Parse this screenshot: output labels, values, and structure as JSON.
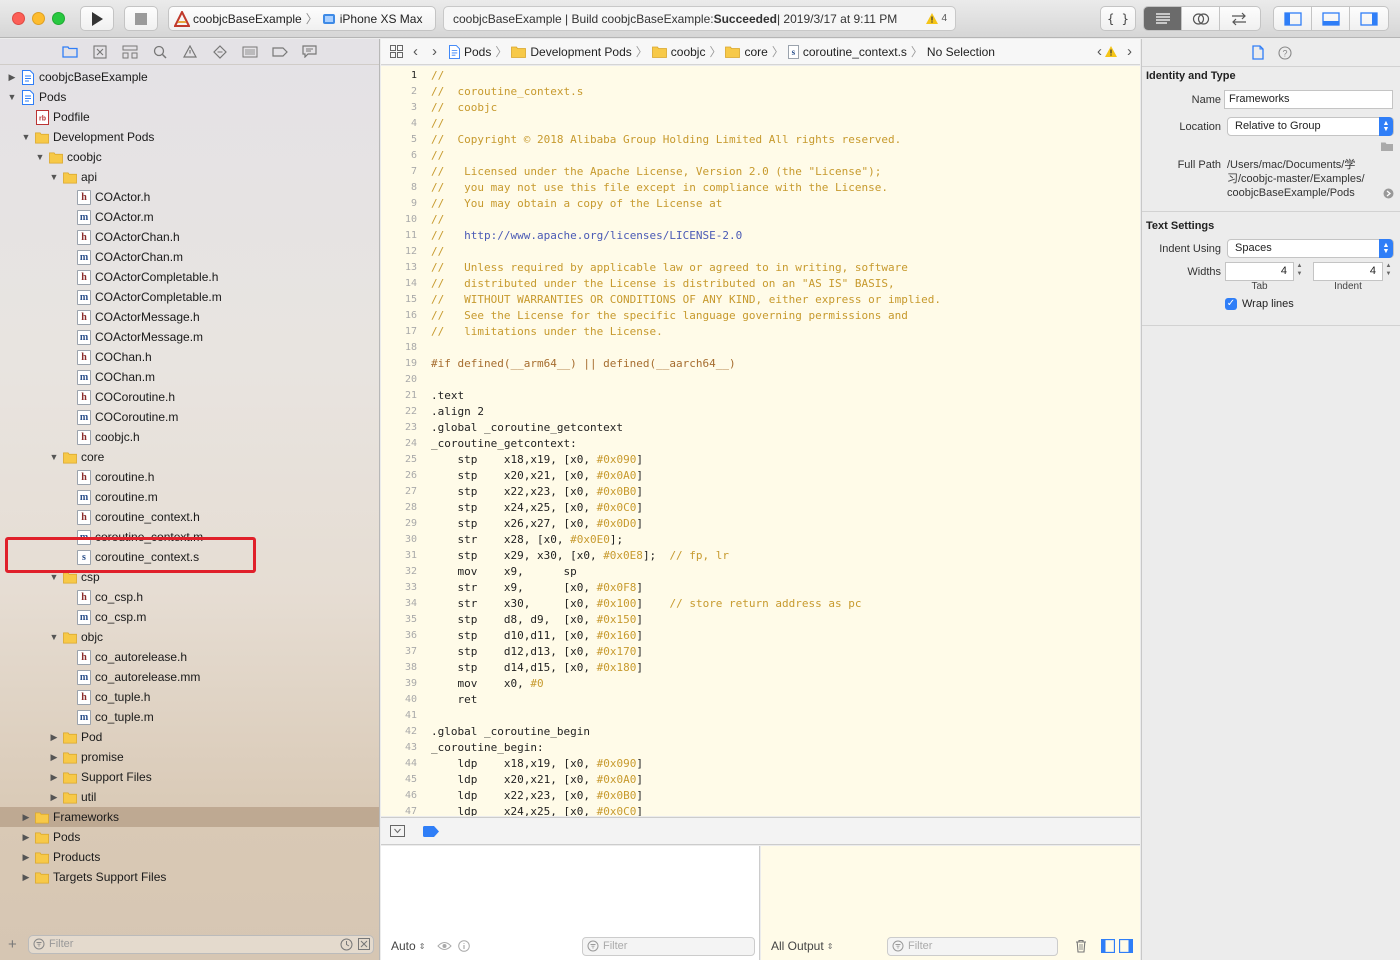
{
  "toolbar": {
    "scheme_name": "coobjcBaseExample",
    "device_name": "iPhone XS Max",
    "activity_prefix": "coobjcBaseExample | Build coobjcBaseExample: ",
    "activity_status": "Succeeded",
    "activity_time": " | 2019/3/17 at 9:11 PM",
    "warning_count": "4",
    "colors": {
      "close": "#fc5f57",
      "minimize": "#fdbc2e",
      "zoom": "#28c840",
      "accent": "#2f7ef7"
    }
  },
  "navigator": {
    "tabs": [
      "folder-icon",
      "source-control-icon",
      "symbol-icon",
      "search-icon",
      "issue-icon",
      "test-icon",
      "debug-icon",
      "breakpoint-icon",
      "report-icon"
    ],
    "items": [
      {
        "label": "coobjcBaseExample",
        "kind": "project",
        "disclosure": "closed",
        "indent": 0
      },
      {
        "label": "Pods",
        "kind": "project",
        "disclosure": "open",
        "indent": 0
      },
      {
        "label": "Podfile",
        "kind": "rb",
        "disclosure": "",
        "indent": 1
      },
      {
        "label": "Development Pods",
        "kind": "folder",
        "disclosure": "open",
        "indent": 1
      },
      {
        "label": "coobjc",
        "kind": "folder",
        "disclosure": "open",
        "indent": 2
      },
      {
        "label": "api",
        "kind": "folder",
        "disclosure": "open",
        "indent": 3
      },
      {
        "label": "COActor.h",
        "kind": "h",
        "disclosure": "",
        "indent": 4
      },
      {
        "label": "COActor.m",
        "kind": "m",
        "disclosure": "",
        "indent": 4
      },
      {
        "label": "COActorChan.h",
        "kind": "h",
        "disclosure": "",
        "indent": 4
      },
      {
        "label": "COActorChan.m",
        "kind": "m",
        "disclosure": "",
        "indent": 4
      },
      {
        "label": "COActorCompletable.h",
        "kind": "h",
        "disclosure": "",
        "indent": 4
      },
      {
        "label": "COActorCompletable.m",
        "kind": "m",
        "disclosure": "",
        "indent": 4
      },
      {
        "label": "COActorMessage.h",
        "kind": "h",
        "disclosure": "",
        "indent": 4
      },
      {
        "label": "COActorMessage.m",
        "kind": "m",
        "disclosure": "",
        "indent": 4
      },
      {
        "label": "COChan.h",
        "kind": "h",
        "disclosure": "",
        "indent": 4
      },
      {
        "label": "COChan.m",
        "kind": "m",
        "disclosure": "",
        "indent": 4
      },
      {
        "label": "COCoroutine.h",
        "kind": "h",
        "disclosure": "",
        "indent": 4
      },
      {
        "label": "COCoroutine.m",
        "kind": "m",
        "disclosure": "",
        "indent": 4
      },
      {
        "label": "coobjc.h",
        "kind": "h",
        "disclosure": "",
        "indent": 4
      },
      {
        "label": "core",
        "kind": "folder",
        "disclosure": "open",
        "indent": 3
      },
      {
        "label": "coroutine.h",
        "kind": "h",
        "disclosure": "",
        "indent": 4
      },
      {
        "label": "coroutine.m",
        "kind": "m",
        "disclosure": "",
        "indent": 4
      },
      {
        "label": "coroutine_context.h",
        "kind": "h",
        "disclosure": "",
        "indent": 4
      },
      {
        "label": "coroutine_context.m",
        "kind": "m",
        "disclosure": "",
        "indent": 4
      },
      {
        "label": "coroutine_context.s",
        "kind": "s",
        "disclosure": "",
        "indent": 4
      },
      {
        "label": "csp",
        "kind": "folder",
        "disclosure": "open",
        "indent": 3
      },
      {
        "label": "co_csp.h",
        "kind": "h",
        "disclosure": "",
        "indent": 4
      },
      {
        "label": "co_csp.m",
        "kind": "m",
        "disclosure": "",
        "indent": 4
      },
      {
        "label": "objc",
        "kind": "folder",
        "disclosure": "open",
        "indent": 3
      },
      {
        "label": "co_autorelease.h",
        "kind": "h",
        "disclosure": "",
        "indent": 4
      },
      {
        "label": "co_autorelease.mm",
        "kind": "m",
        "disclosure": "",
        "indent": 4
      },
      {
        "label": "co_tuple.h",
        "kind": "h",
        "disclosure": "",
        "indent": 4
      },
      {
        "label": "co_tuple.m",
        "kind": "m",
        "disclosure": "",
        "indent": 4
      },
      {
        "label": "Pod",
        "kind": "folder",
        "disclosure": "closed",
        "indent": 3
      },
      {
        "label": "promise",
        "kind": "folder",
        "disclosure": "closed",
        "indent": 3
      },
      {
        "label": "Support Files",
        "kind": "folder",
        "disclosure": "closed",
        "indent": 3
      },
      {
        "label": "util",
        "kind": "folder",
        "disclosure": "closed",
        "indent": 3
      },
      {
        "label": "Frameworks",
        "kind": "folder",
        "disclosure": "closed",
        "indent": 1,
        "selected": true
      },
      {
        "label": "Pods",
        "kind": "folder",
        "disclosure": "closed",
        "indent": 1
      },
      {
        "label": "Products",
        "kind": "folder",
        "disclosure": "closed",
        "indent": 1
      },
      {
        "label": "Targets Support Files",
        "kind": "folder",
        "disclosure": "closed",
        "indent": 1
      }
    ],
    "filter_placeholder": "Filter"
  },
  "jumpbar": {
    "crumbs": [
      "Pods",
      "Development Pods",
      "coobjc",
      "core",
      "coroutine_context.s",
      "No Selection"
    ]
  },
  "editor": {
    "current_line": 1,
    "lines": [
      {
        "n": "1",
        "t": "//",
        "k": "cmt"
      },
      {
        "n": "2",
        "t": "//  coroutine_context.s",
        "k": "cmt"
      },
      {
        "n": "3",
        "t": "//  coobjc",
        "k": "cmt"
      },
      {
        "n": "4",
        "t": "//",
        "k": "cmt"
      },
      {
        "n": "5",
        "t": "//  Copyright © 2018 Alibaba Group Holding Limited All rights reserved.",
        "k": "cmt"
      },
      {
        "n": "6",
        "t": "//",
        "k": "cmt"
      },
      {
        "n": "7",
        "t": "//   Licensed under the Apache License, Version 2.0 (the \"License\");",
        "k": "cmt"
      },
      {
        "n": "8",
        "t": "//   you may not use this file except in compliance with the License.",
        "k": "cmt"
      },
      {
        "n": "9",
        "t": "//   You may obtain a copy of the License at",
        "k": "cmt"
      },
      {
        "n": "10",
        "t": "//",
        "k": "cmt"
      },
      {
        "n": "11",
        "t": "//   http://www.apache.org/licenses/LICENSE-2.0",
        "k": "url"
      },
      {
        "n": "12",
        "t": "//",
        "k": "cmt"
      },
      {
        "n": "13",
        "t": "//   Unless required by applicable law or agreed to in writing, software",
        "k": "cmt"
      },
      {
        "n": "14",
        "t": "//   distributed under the License is distributed on an \"AS IS\" BASIS,",
        "k": "cmt"
      },
      {
        "n": "15",
        "t": "//   WITHOUT WARRANTIES OR CONDITIONS OF ANY KIND, either express or implied.",
        "k": "cmt"
      },
      {
        "n": "16",
        "t": "//   See the License for the specific language governing permissions and",
        "k": "cmt"
      },
      {
        "n": "17",
        "t": "//   limitations under the License.",
        "k": "cmt"
      },
      {
        "n": "18",
        "t": "",
        "k": "plain"
      },
      {
        "n": "19",
        "t": "#if defined(__arm64__) || defined(__aarch64__)",
        "k": "pp"
      },
      {
        "n": "20",
        "t": "",
        "k": "plain"
      },
      {
        "n": "21",
        "t": ".text",
        "k": "plain"
      },
      {
        "n": "22",
        "t": ".align 2",
        "k": "plain"
      },
      {
        "n": "23",
        "t": ".global _coroutine_getcontext",
        "k": "plain"
      },
      {
        "n": "24",
        "t": "_coroutine_getcontext:",
        "k": "plain"
      },
      {
        "n": "25",
        "t": "    stp    x18,x19, [x0, #0x090]",
        "k": "asm"
      },
      {
        "n": "26",
        "t": "    stp    x20,x21, [x0, #0x0A0]",
        "k": "asm"
      },
      {
        "n": "27",
        "t": "    stp    x22,x23, [x0, #0x0B0]",
        "k": "asm"
      },
      {
        "n": "28",
        "t": "    stp    x24,x25, [x0, #0x0C0]",
        "k": "asm"
      },
      {
        "n": "29",
        "t": "    stp    x26,x27, [x0, #0x0D0]",
        "k": "asm"
      },
      {
        "n": "30",
        "t": "    str    x28, [x0, #0x0E0];",
        "k": "asm"
      },
      {
        "n": "31",
        "t": "    stp    x29, x30, [x0, #0x0E8];  // fp, lr",
        "k": "asm"
      },
      {
        "n": "32",
        "t": "    mov    x9,      sp",
        "k": "asm"
      },
      {
        "n": "33",
        "t": "    str    x9,      [x0, #0x0F8]",
        "k": "asm"
      },
      {
        "n": "34",
        "t": "    str    x30,     [x0, #0x100]    // store return address as pc",
        "k": "asm"
      },
      {
        "n": "35",
        "t": "    stp    d8, d9,  [x0, #0x150]",
        "k": "asm"
      },
      {
        "n": "36",
        "t": "    stp    d10,d11, [x0, #0x160]",
        "k": "asm"
      },
      {
        "n": "37",
        "t": "    stp    d12,d13, [x0, #0x170]",
        "k": "asm"
      },
      {
        "n": "38",
        "t": "    stp    d14,d15, [x0, #0x180]",
        "k": "asm"
      },
      {
        "n": "39",
        "t": "    mov    x0, #0",
        "k": "asm"
      },
      {
        "n": "40",
        "t": "    ret",
        "k": "plain"
      },
      {
        "n": "41",
        "t": "",
        "k": "plain"
      },
      {
        "n": "42",
        "t": ".global _coroutine_begin",
        "k": "plain"
      },
      {
        "n": "43",
        "t": "_coroutine_begin:",
        "k": "plain"
      },
      {
        "n": "44",
        "t": "    ldp    x18,x19, [x0, #0x090]",
        "k": "asm"
      },
      {
        "n": "45",
        "t": "    ldp    x20,x21, [x0, #0x0A0]",
        "k": "asm"
      },
      {
        "n": "46",
        "t": "    ldp    x22,x23, [x0, #0x0B0]",
        "k": "asm"
      },
      {
        "n": "47",
        "t": "    ldp    x24,x25, [x0, #0x0C0]",
        "k": "asm"
      }
    ]
  },
  "debug": {
    "auto_label": "Auto",
    "var_filter_placeholder": "Filter",
    "output_label": "All Output",
    "console_filter_placeholder": "Filter"
  },
  "inspector": {
    "identity_title": "Identity and Type",
    "name_label": "Name",
    "name_value": "Frameworks",
    "location_label": "Location",
    "location_value": "Relative to Group",
    "fullpath_label": "Full Path",
    "fullpath_lines": [
      "/Users/mac/Documents/学",
      "习/coobjc-master/Examples/",
      "coobjcBaseExample/Pods"
    ],
    "text_settings_title": "Text Settings",
    "indent_using_label": "Indent Using",
    "indent_using_value": "Spaces",
    "widths_label": "Widths",
    "tab_value": "4",
    "indent_value": "4",
    "tab_caption": "Tab",
    "indent_caption": "Indent",
    "wrap_lines_label": "Wrap lines",
    "wrap_lines_checked": true
  }
}
